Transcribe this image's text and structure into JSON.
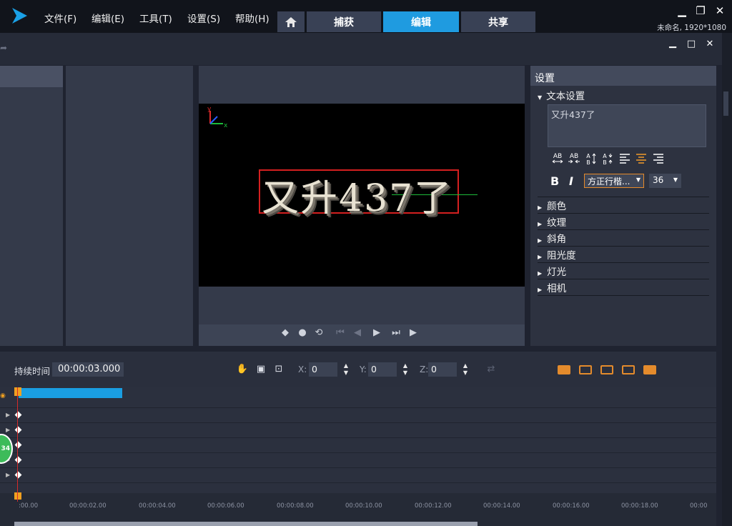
{
  "menu": {
    "file": "文件(F)",
    "edit": "编辑(E)",
    "tools": "工具(T)",
    "settings": "设置(S)",
    "help": "帮助(H)"
  },
  "tabs": {
    "capture": "捕获",
    "edit": "编辑",
    "share": "共享"
  },
  "project_info": "未命名, 1920*1080",
  "preview": {
    "title_text": "又升437了",
    "axis_y": "y",
    "axis_x": "x"
  },
  "settings": {
    "title": "设置",
    "text_settings": "文本设置",
    "text_value": "又升437了",
    "bold": "B",
    "italic": "I",
    "font": "方正行楷...",
    "size": "36",
    "sections": [
      "颜色",
      "纹理",
      "斜角",
      "阻光度",
      "灯光",
      "相机"
    ]
  },
  "timeline": {
    "duration_label": "持续时间",
    "duration_value": "00:00:03.000",
    "x_label": "X:",
    "x_value": "0",
    "y_label": "Y:",
    "y_value": "0",
    "z_label": "Z:",
    "z_value": "0",
    "badge": "34",
    "ticks": [
      ":00.00",
      "00:00:02.00",
      "00:00:04.00",
      "00:00:06.00",
      "00:00:08.00",
      "00:00:10.00",
      "00:00:12.00",
      "00:00:14.00",
      "00:00:16.00",
      "00:00:18.00",
      "00:00"
    ]
  },
  "colors": {
    "accent": "#1f9be0",
    "clip": "#1a9ee2",
    "highlight": "#e58a2a"
  }
}
